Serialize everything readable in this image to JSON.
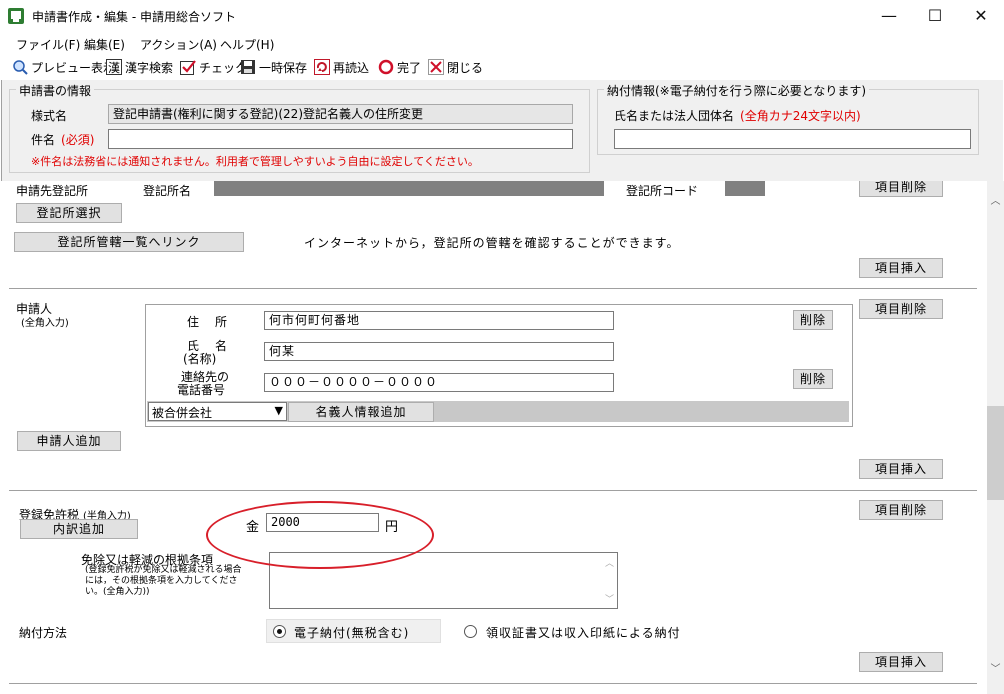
{
  "window": {
    "title": "申請書作成・編集 - 申請用総合ソフト",
    "minimize": "—",
    "maximize": "☐",
    "close": "✕"
  },
  "menu": [
    "ファイル(F)",
    "編集(E)",
    "アクション(A)",
    "ヘルプ(H)"
  ],
  "toolbar": {
    "preview": "プレビュー表示",
    "kanji": "漢字検索",
    "check": "チェック",
    "save": "一時保存",
    "reload": "再読込",
    "done": "完了",
    "close": "閉じる"
  },
  "app_info": {
    "group_title": "申請書の情報",
    "form_name_label": "様式名",
    "form_name_value": "登記申請書(権利に関する登記)(22)登記名義人の住所変更",
    "subject_label": "件名",
    "required": "(必須)",
    "subject_value": "",
    "note": "※件名は法務省には通知されません。利用者で管理しやすいよう自由に設定してください。"
  },
  "payment_info": {
    "group_title": "納付情報(※電子納付を行う際に必要となります)",
    "name_label": "氏名または法人団体名",
    "name_hint": "(全角カナ24文字以内)",
    "name_value": ""
  },
  "registry": {
    "section_label": "申請先登記所",
    "office_name_label": "登記所名",
    "office_code_label": "登記所コード",
    "select_button": "登記所選択",
    "link_button": "登記所管轄一覧へリンク",
    "info_text": "インターネットから，登記所の管轄を確認することができます。",
    "delete_button": "項目削除",
    "insert_button": "項目挿入"
  },
  "applicant": {
    "section_label": "申請人",
    "section_hint": "(全角入力)",
    "address_label": "住　所",
    "address_value": "何市何町何番地",
    "name_label_1": "氏　名",
    "name_label_2": "(名称)",
    "name_value": "何某",
    "phone_label_1": "連絡先の",
    "phone_label_2": "電話番号",
    "phone_value": "０００－００００－００００",
    "delete_small": "削除",
    "delete_small_2": "削除",
    "merged_select": "被合併会社",
    "add_nominee_button": "名義人情報追加",
    "add_applicant_button": "申請人追加",
    "delete_button": "項目削除",
    "insert_button": "項目挿入"
  },
  "tax": {
    "section_label": "登録免許税",
    "section_hint": "(半角入力)",
    "breakdown_button": "内訳追加",
    "amount_prefix": "金",
    "amount_value": "2000",
    "amount_unit": "円",
    "exemption_label": "免除又は軽減の根拠条項",
    "exemption_hint": "(登録免許税が免除又は軽減される場合には，その根拠条項を入力してください。(全角入力))",
    "exemption_value": "",
    "payment_method_label": "納付方法",
    "option_electronic": "電子納付(無税含む)",
    "option_stamp": "領収証書又は収入印紙による納付",
    "delete_button": "項目削除",
    "insert_button": "項目挿入"
  }
}
